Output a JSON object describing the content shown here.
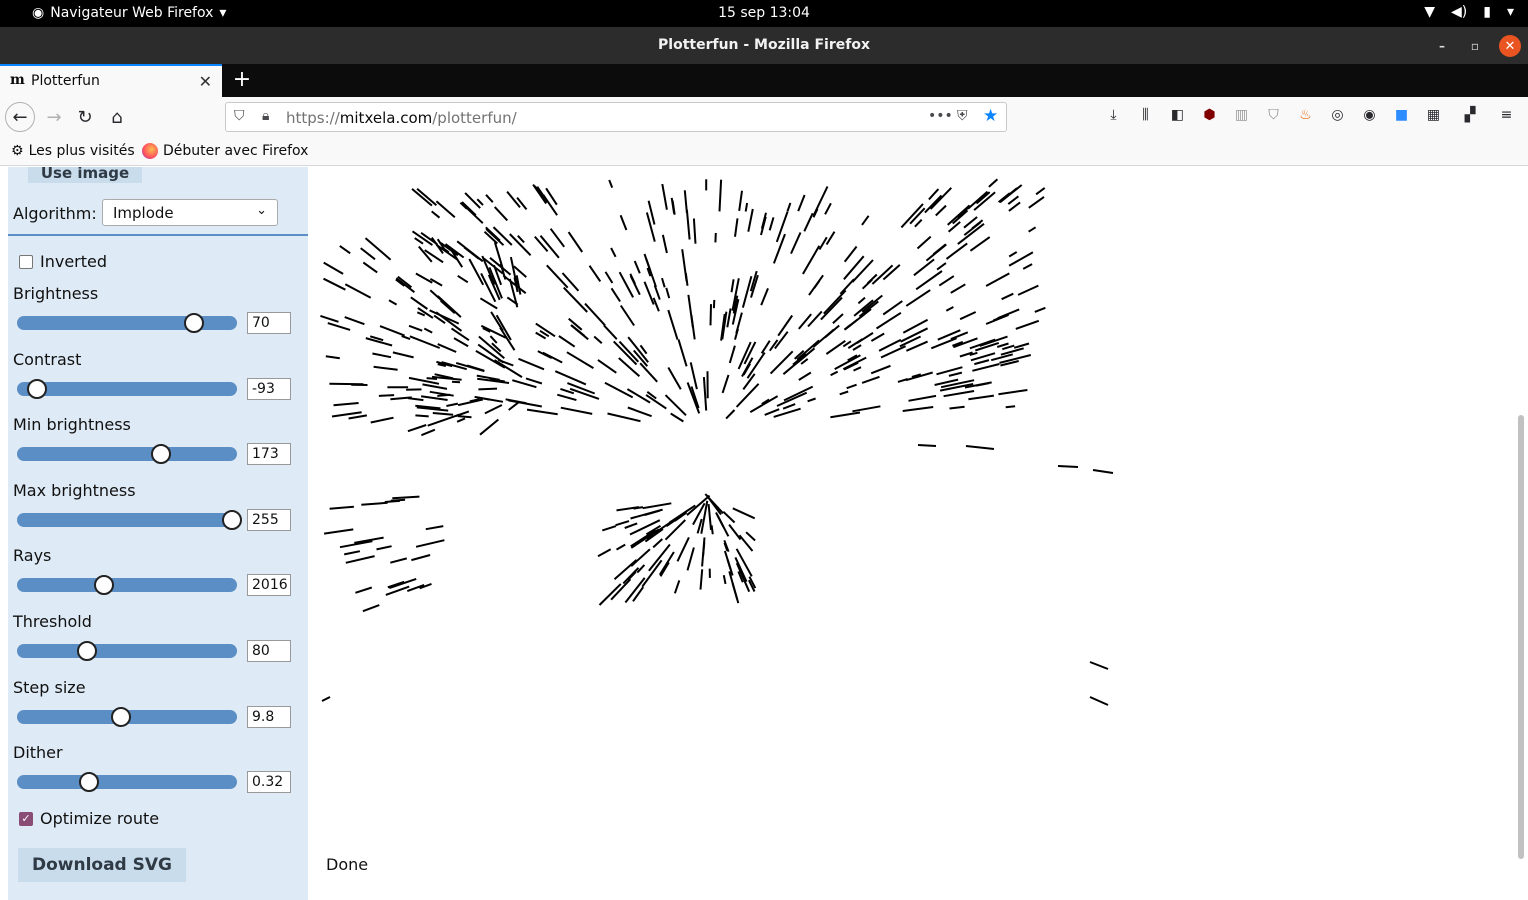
{
  "system": {
    "app_menu": "Navigateur Web Firefox",
    "clock": "15 sep  13:04"
  },
  "window": {
    "title": "Plotterfun - Mozilla Firefox"
  },
  "tab": {
    "favicon": "m",
    "label": "Plotterfun"
  },
  "urlbar": {
    "scheme": "https://",
    "host": "mitxela.com",
    "path": "/plotterfun/"
  },
  "bookmarks": [
    "Les plus visités",
    "Débuter avec Firefox"
  ],
  "panel": {
    "use_image": "Use image",
    "algorithm_label": "Algorithm:",
    "algorithm_value": "Implode",
    "inverted": {
      "label": "Inverted",
      "checked": false
    },
    "sliders": [
      {
        "label": "Brightness",
        "value": "70",
        "fraction": 0.82
      },
      {
        "label": "Contrast",
        "value": "-93",
        "fraction": 0.07
      },
      {
        "label": "Min brightness",
        "value": "173",
        "fraction": 0.66
      },
      {
        "label": "Max brightness",
        "value": "255",
        "fraction": 1.0
      },
      {
        "label": "Rays",
        "value": "2016",
        "fraction": 0.39
      },
      {
        "label": "Threshold",
        "value": "80",
        "fraction": 0.31
      },
      {
        "label": "Step size",
        "value": "9.8",
        "fraction": 0.47
      },
      {
        "label": "Dither",
        "value": "0.32",
        "fraction": 0.32
      }
    ],
    "optimize": {
      "label": "Optimize route",
      "checked": true
    },
    "download": "Download SVG"
  },
  "status": "Done",
  "colors": {
    "accent": "#5b8ec5",
    "panel": "#deeaf5",
    "check": "#8a4d76"
  }
}
